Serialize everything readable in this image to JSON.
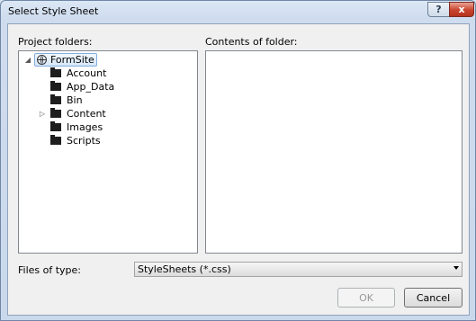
{
  "window": {
    "title": "Select Style Sheet"
  },
  "titlebar_buttons": {
    "help": "?",
    "close": "x"
  },
  "labels": {
    "project_folders": "Project folders:",
    "contents_of_folder": "Contents of folder:",
    "files_of_type": "Files of type:"
  },
  "tree": {
    "root": {
      "label": "FormSite",
      "icon": "globe-icon",
      "expanded": true,
      "selected": true
    },
    "children": [
      {
        "label": "Account",
        "icon": "folder-icon",
        "expandable": false
      },
      {
        "label": "App_Data",
        "icon": "folder-icon",
        "expandable": false
      },
      {
        "label": "Bin",
        "icon": "folder-icon",
        "expandable": false
      },
      {
        "label": "Content",
        "icon": "folder-icon",
        "expandable": true
      },
      {
        "label": "Images",
        "icon": "folder-icon",
        "expandable": false
      },
      {
        "label": "Scripts",
        "icon": "folder-icon",
        "expandable": false
      }
    ]
  },
  "file_type": {
    "selected": "StyleSheets (*.css)"
  },
  "buttons": {
    "ok": "OK",
    "cancel": "Cancel"
  }
}
